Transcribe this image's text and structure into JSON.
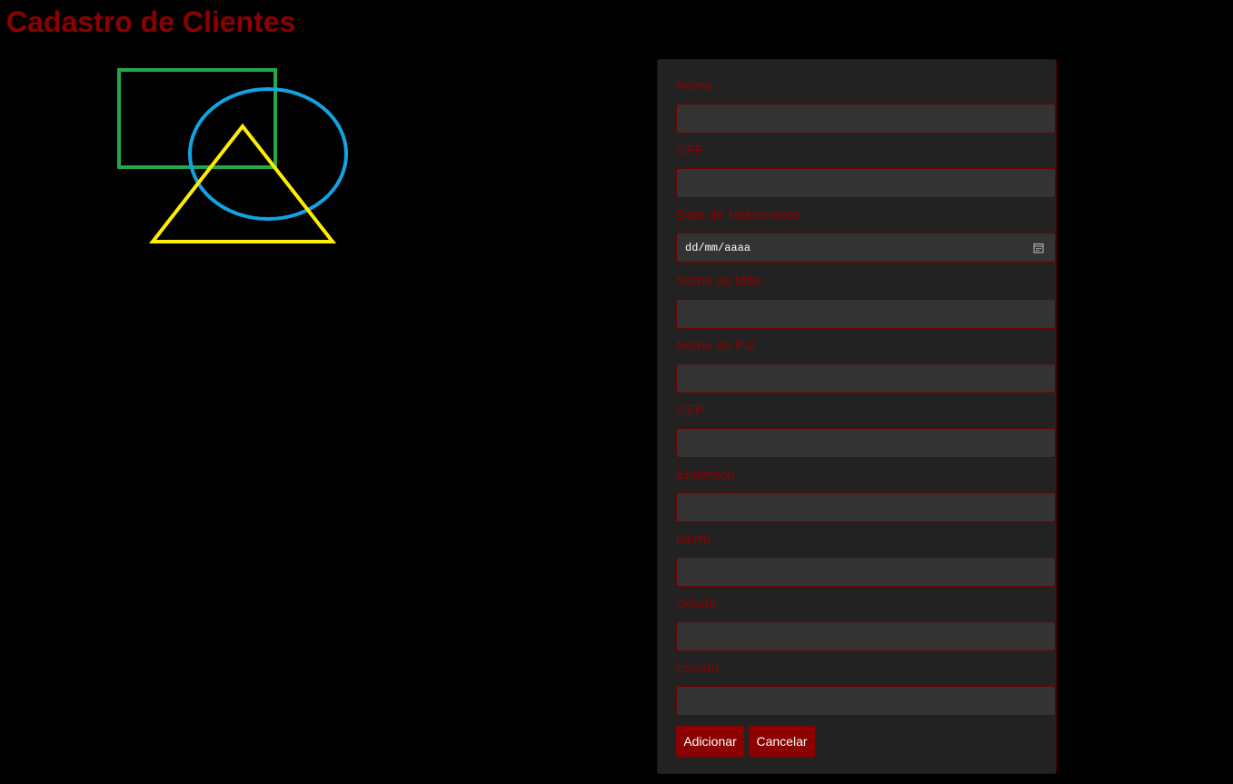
{
  "page": {
    "title": "Cadastro de Clientes",
    "colors": {
      "background": "#000000",
      "accent": "#8b0000",
      "panel": "#222222",
      "input": "#333333",
      "logo_rectangle": "#22a84a",
      "logo_ellipse": "#12a3e2",
      "logo_triangle": "#ffee00"
    }
  },
  "logo": {
    "shapes": [
      "rectangle",
      "ellipse",
      "triangle"
    ]
  },
  "form": {
    "fields": [
      {
        "label": "Nome",
        "value": ""
      },
      {
        "label": "CPF",
        "value": ""
      },
      {
        "label": "Data de Nascimento",
        "value": "",
        "placeholder": "dd/mm/aaaa"
      },
      {
        "label": "Nome da Mãe",
        "value": ""
      },
      {
        "label": "Nome do Pai",
        "value": ""
      },
      {
        "label": "CEP",
        "value": ""
      },
      {
        "label": "Endereço",
        "value": ""
      },
      {
        "label": "bairro",
        "value": ""
      },
      {
        "label": "cidade",
        "value": ""
      },
      {
        "label": "Estado",
        "value": ""
      }
    ],
    "buttons": {
      "add_label": "Adicionar",
      "cancel_label": "Cancelar"
    }
  }
}
